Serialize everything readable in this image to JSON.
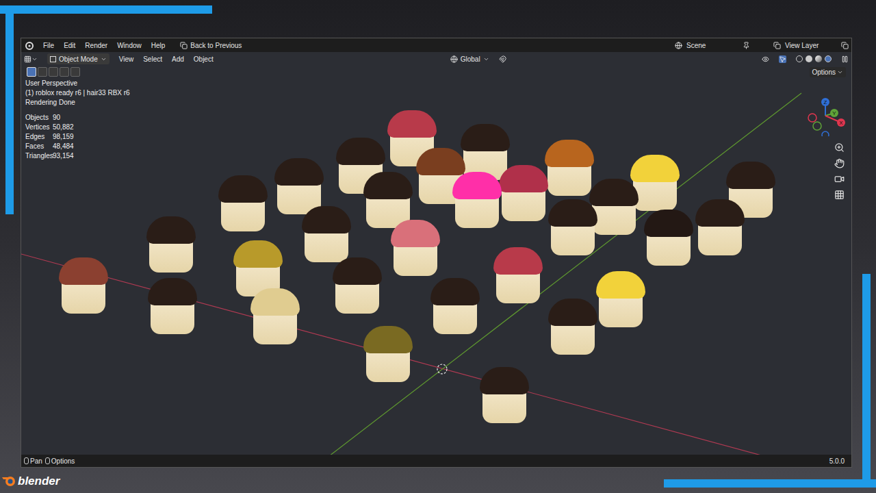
{
  "menu_bar": {
    "items": [
      "File",
      "Edit",
      "Render",
      "Window",
      "Help"
    ],
    "back_button": "Back to Previous",
    "scene": "Scene",
    "view_layer": "View Layer"
  },
  "header": {
    "mode": "Object Mode",
    "menus": [
      "View",
      "Select",
      "Add",
      "Object"
    ],
    "orientation": "Global",
    "options": "Options"
  },
  "tools": [
    {
      "selected": true
    },
    {
      "selected": false
    },
    {
      "selected": false
    },
    {
      "selected": false
    },
    {
      "selected": false
    }
  ],
  "viewport": {
    "view_name": "User Perspective",
    "active_object": "(1) roblox ready r6 | hair33 RBX r6",
    "status": "Rendering Done",
    "stats": [
      {
        "label": "Objects",
        "value": "90"
      },
      {
        "label": "Vertices",
        "value": "50,882"
      },
      {
        "label": "Edges",
        "value": "98,159"
      },
      {
        "label": "Faces",
        "value": "48,484"
      },
      {
        "label": "Triangles",
        "value": "93,154"
      }
    ],
    "gizmo": [
      {
        "label": "Z",
        "color": "#2f6fd6"
      },
      {
        "label": "Y",
        "color": "#5fa338"
      },
      {
        "label": "X",
        "color": "#e0364f"
      }
    ],
    "heads": [
      {
        "color": "#b83a4a"
      },
      {
        "color": "#2a1d17"
      },
      {
        "color": "#2a1d17"
      },
      {
        "color": "#b8651e"
      },
      {
        "color": "#2a1d17"
      },
      {
        "color": "#7a3e1f"
      },
      {
        "color": "#b0304a"
      },
      {
        "color": "#f2d23a"
      },
      {
        "color": "#2a1d17"
      },
      {
        "color": "#2a1d17"
      },
      {
        "color": "#2a1d17"
      },
      {
        "color": "#ff2fa8"
      },
      {
        "color": "#2a1d17"
      },
      {
        "color": "#2a1d17"
      },
      {
        "color": "#2a1d17"
      },
      {
        "color": "#2a1d17"
      },
      {
        "color": "#231814"
      },
      {
        "color": "#2a1d17"
      },
      {
        "color": "#d9707a"
      },
      {
        "color": "#b89a2a"
      },
      {
        "color": "#8b4030"
      },
      {
        "color": "#2a1d17"
      },
      {
        "color": "#b83a4a"
      },
      {
        "color": "#2a1d17"
      },
      {
        "color": "#e0cc90"
      },
      {
        "color": "#2a1d17"
      },
      {
        "color": "#f2d23a"
      },
      {
        "color": "#7a6a22"
      },
      {
        "color": "#2a1d17"
      },
      {
        "color": "#2a1d17"
      }
    ]
  },
  "status_bar": {
    "hints": [
      "Pan",
      "Options"
    ],
    "version": "5.0.0"
  },
  "branding": {
    "name": "blender"
  }
}
